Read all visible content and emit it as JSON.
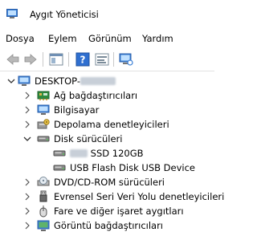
{
  "window": {
    "title": "Aygıt Yöneticisi"
  },
  "menu": {
    "items": [
      "Dosya",
      "Eylem",
      "Görünüm",
      "Yardım"
    ]
  },
  "tree": {
    "root": "DESKTOP-",
    "categories": [
      {
        "label": "Ağ bağdaştırıcıları",
        "icon": "network-adapter-icon",
        "expanded": false
      },
      {
        "label": "Bilgisayar",
        "icon": "computer-icon",
        "expanded": false
      },
      {
        "label": "Depolama denetleyicileri",
        "icon": "storage-controller-icon",
        "expanded": false
      },
      {
        "label": "Disk sürücüleri",
        "icon": "disk-drive-icon",
        "expanded": true,
        "children": [
          "SSD 120GB",
          "USB Flash Disk USB Device"
        ]
      },
      {
        "label": "DVD/CD-ROM sürücüleri",
        "icon": "dvd-drive-icon",
        "expanded": false
      },
      {
        "label": "Evrensel Seri Veri Yolu denetleyicileri",
        "icon": "usb-controller-icon",
        "expanded": false
      },
      {
        "label": "Fare ve diğer işaret aygıtları",
        "icon": "mouse-icon",
        "expanded": false
      },
      {
        "label": "Görüntü bağdaştırıcıları",
        "icon": "display-adapter-icon",
        "expanded": false
      }
    ]
  }
}
